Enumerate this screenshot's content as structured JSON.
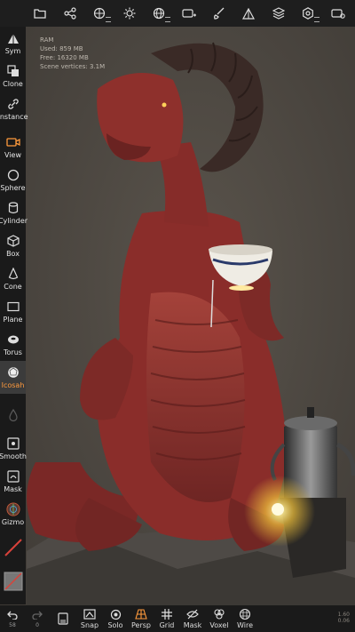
{
  "stats": {
    "ram_label": "RAM",
    "used": "Used: 859 MB",
    "free": "Free: 16320 MB",
    "vertices": "Scene vertices: 3.1M"
  },
  "topbar": {
    "icons": [
      "folder-icon",
      "scene-graph-icon",
      "gizmo-settings-icon",
      "sun-icon",
      "globe-icon",
      "camera-plus-icon",
      "brush-icon",
      "triangle-icon",
      "layers-icon",
      "settings-icon",
      "camera-settings-icon"
    ]
  },
  "leftbar": {
    "tools": [
      {
        "label": "Sym"
      },
      {
        "label": "Clone"
      },
      {
        "label": "Instance"
      },
      {
        "label": "View"
      },
      {
        "label": "Sphere"
      },
      {
        "label": "Cylinder"
      },
      {
        "label": "Box"
      },
      {
        "label": "Cone"
      },
      {
        "label": "Plane"
      },
      {
        "label": "Torus"
      },
      {
        "label": "Icosah"
      },
      {
        "label": "Smooth"
      },
      {
        "label": "Mask"
      },
      {
        "label": "Gizmo"
      }
    ]
  },
  "bottombar": {
    "undo_count": "58",
    "redo_count": "0",
    "items": [
      {
        "label": "Snap"
      },
      {
        "label": "Solo"
      },
      {
        "label": "Persp"
      },
      {
        "label": "Grid"
      },
      {
        "label": "Mask"
      },
      {
        "label": "Voxel"
      },
      {
        "label": "Wire"
      }
    ]
  },
  "version": {
    "line1": "1.60",
    "line2": "0.06"
  },
  "colors": {
    "accent": "#ff9a3c",
    "panel": "#1a1a1a",
    "dragon": "#8c2f2c"
  }
}
